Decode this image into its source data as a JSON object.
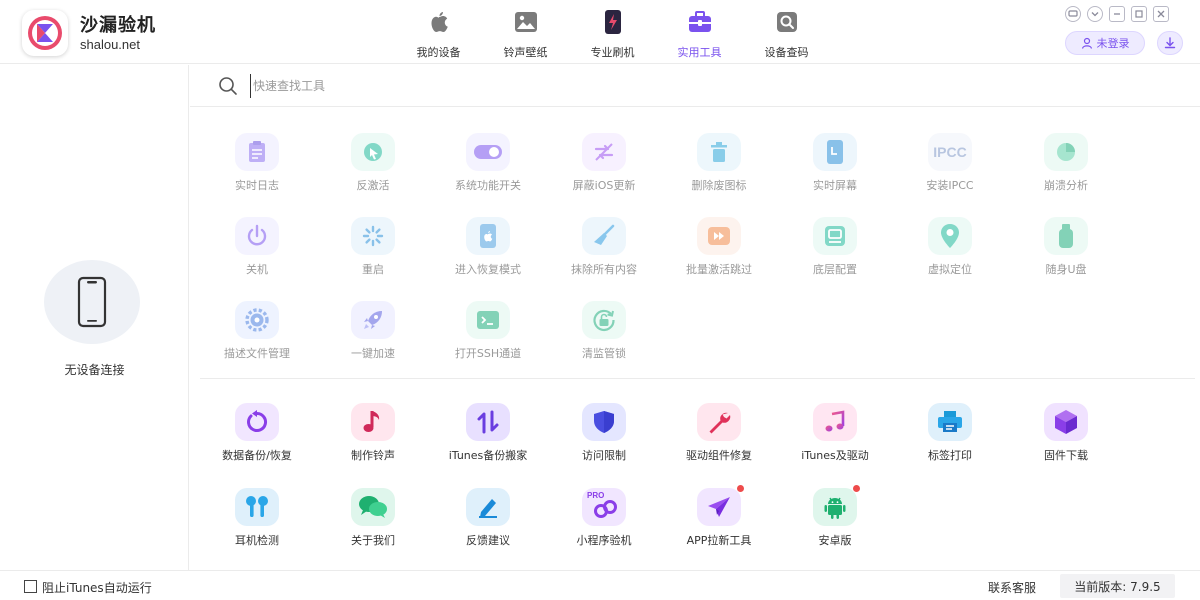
{
  "brand": {
    "name": "沙漏验机",
    "url": "shalou.net"
  },
  "nav": [
    {
      "label": "我的设备",
      "icon": "apple-icon"
    },
    {
      "label": "铃声壁纸",
      "icon": "image-icon"
    },
    {
      "label": "专业刷机",
      "icon": "flash-phone-icon"
    },
    {
      "label": "实用工具",
      "icon": "toolbox-icon",
      "active": true
    },
    {
      "label": "设备查码",
      "icon": "search-code-icon"
    }
  ],
  "account": {
    "login_label": "未登录"
  },
  "device": {
    "status": "无设备连接"
  },
  "search": {
    "placeholder": "快速查找工具"
  },
  "tools_disabled": [
    {
      "label": "实时日志",
      "icon": "log-icon"
    },
    {
      "label": "反激活",
      "icon": "deactivate-icon"
    },
    {
      "label": "系统功能开关",
      "icon": "toggle-icon"
    },
    {
      "label": "屏蔽iOS更新",
      "icon": "block-update-icon"
    },
    {
      "label": "删除废图标",
      "icon": "trash-icon"
    },
    {
      "label": "实时屏幕",
      "icon": "screen-icon"
    },
    {
      "label": "安装IPCC",
      "icon": "ipcc-icon",
      "text": "IPCC"
    },
    {
      "label": "崩溃分析",
      "icon": "pie-chart-icon"
    },
    {
      "label": "关机",
      "icon": "power-icon"
    },
    {
      "label": "重启",
      "icon": "restart-icon"
    },
    {
      "label": "进入恢复模式",
      "icon": "recovery-icon"
    },
    {
      "label": "抹除所有内容",
      "icon": "broom-icon"
    },
    {
      "label": "批量激活跳过",
      "icon": "skip-icon"
    },
    {
      "label": "底层配置",
      "icon": "config-icon"
    },
    {
      "label": "虚拟定位",
      "icon": "location-icon"
    },
    {
      "label": "随身U盘",
      "icon": "usb-icon"
    },
    {
      "label": "描述文件管理",
      "icon": "profile-gear-icon"
    },
    {
      "label": "一键加速",
      "icon": "rocket-icon"
    },
    {
      "label": "打开SSH通道",
      "icon": "terminal-icon"
    },
    {
      "label": "清监管锁",
      "icon": "unlock-icon"
    }
  ],
  "tools_enabled": [
    {
      "label": "数据备份/恢复",
      "icon": "backup-icon"
    },
    {
      "label": "制作铃声",
      "icon": "music-note-icon"
    },
    {
      "label": "iTunes备份搬家",
      "icon": "transfer-icon"
    },
    {
      "label": "访问限制",
      "icon": "shield-icon"
    },
    {
      "label": "驱动组件修复",
      "icon": "wrench-icon"
    },
    {
      "label": "iTunes及驱动",
      "icon": "itunes-icon"
    },
    {
      "label": "标签打印",
      "icon": "printer-icon"
    },
    {
      "label": "固件下载",
      "icon": "box-icon"
    },
    {
      "label": "耳机检测",
      "icon": "earphones-icon"
    },
    {
      "label": "关于我们",
      "icon": "chat-icon"
    },
    {
      "label": "反馈建议",
      "icon": "edit-icon"
    },
    {
      "label": "小程序验机",
      "icon": "mini-program-icon",
      "text": "PRO"
    },
    {
      "label": "APP拉新工具",
      "icon": "paper-plane-icon",
      "badge": true
    },
    {
      "label": "安卓版",
      "icon": "android-icon",
      "badge": true
    }
  ],
  "footer": {
    "block_itunes_label": "阻止iTunes自动运行",
    "contact_label": "联系客服",
    "version_label": "当前版本: 7.9.5"
  }
}
